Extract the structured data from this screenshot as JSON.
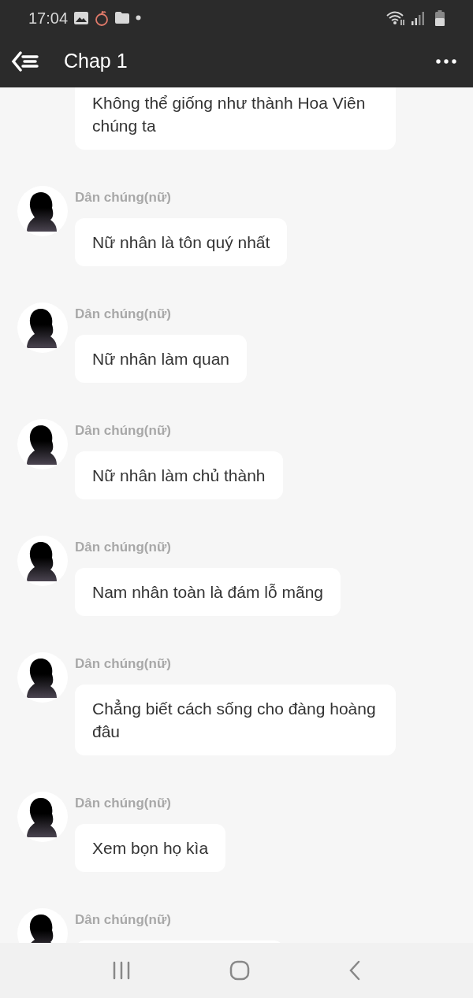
{
  "status_bar": {
    "time": "17:04"
  },
  "header": {
    "title": "Chap 1"
  },
  "messages": [
    {
      "text": "Không thể giống như thành Hoa Viên chúng ta"
    },
    {
      "sender": "Dân chúng(nữ)",
      "text": "Nữ nhân là tôn quý nhất"
    },
    {
      "sender": "Dân chúng(nữ)",
      "text": "Nữ nhân làm quan"
    },
    {
      "sender": "Dân chúng(nữ)",
      "text": "Nữ nhân làm chủ thành"
    },
    {
      "sender": "Dân chúng(nữ)",
      "text": "Nam nhân toàn là đám lỗ mãng"
    },
    {
      "sender": "Dân chúng(nữ)",
      "text": "Chẳng biết cách sống cho đàng hoàng đâu"
    },
    {
      "sender": "Dân chúng(nữ)",
      "text": "Xem bọn họ kìa"
    },
    {
      "sender": "Dân chúng(nữ)"
    }
  ]
}
